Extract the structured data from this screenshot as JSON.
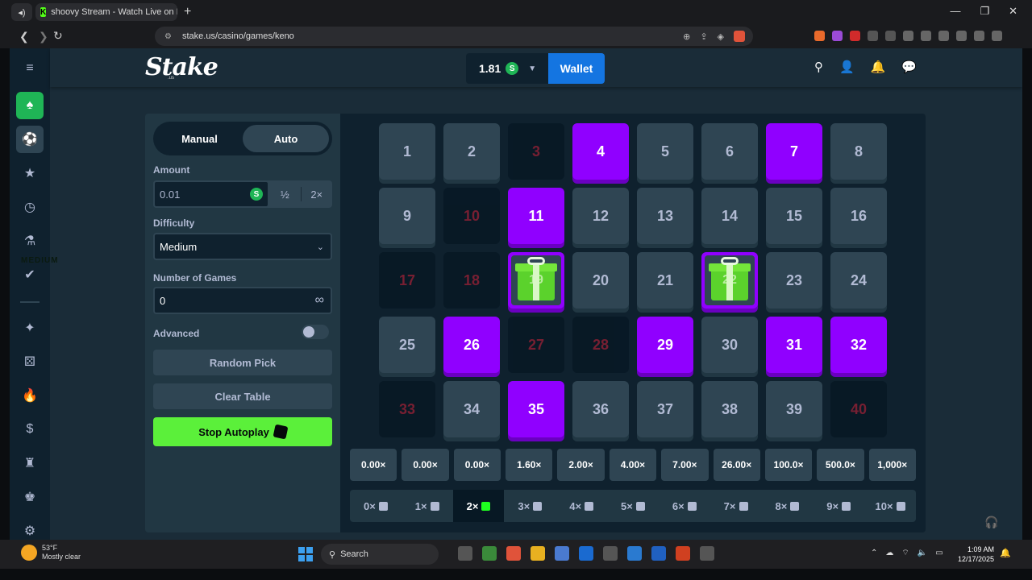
{
  "browser": {
    "tab_title": "shoovy Stream - Watch Live on K",
    "url": "stake.us/casino/games/keno"
  },
  "topbar": {
    "logo": "Stake",
    "logo_sub": ".us",
    "balance": "1.81",
    "currency_symbol": "S",
    "wallet_label": "Wallet"
  },
  "controls": {
    "mode_manual": "Manual",
    "mode_auto": "Auto",
    "amount_label": "Amount",
    "amount_value": "0.01",
    "half_label": "½",
    "double_label": "2×",
    "difficulty_label": "Difficulty",
    "difficulty_value": "Medium",
    "games_label": "Number of Games",
    "games_value": "0",
    "infinity": "∞",
    "advanced_label": "Advanced",
    "random_pick": "Random Pick",
    "clear_table": "Clear Table",
    "stop_autoplay": "Stop Autoplay"
  },
  "board": {
    "tiles": [
      {
        "n": "1",
        "state": "normal"
      },
      {
        "n": "2",
        "state": "normal"
      },
      {
        "n": "3",
        "state": "miss"
      },
      {
        "n": "4",
        "state": "pick"
      },
      {
        "n": "5",
        "state": "normal"
      },
      {
        "n": "6",
        "state": "normal"
      },
      {
        "n": "7",
        "state": "pick"
      },
      {
        "n": "8",
        "state": "normal"
      },
      {
        "n": "9",
        "state": "normal"
      },
      {
        "n": "10",
        "state": "miss"
      },
      {
        "n": "11",
        "state": "pick"
      },
      {
        "n": "12",
        "state": "normal"
      },
      {
        "n": "13",
        "state": "normal"
      },
      {
        "n": "14",
        "state": "normal"
      },
      {
        "n": "15",
        "state": "normal"
      },
      {
        "n": "16",
        "state": "normal"
      },
      {
        "n": "17",
        "state": "miss"
      },
      {
        "n": "18",
        "state": "miss"
      },
      {
        "n": "19",
        "state": "hit"
      },
      {
        "n": "20",
        "state": "normal"
      },
      {
        "n": "21",
        "state": "normal"
      },
      {
        "n": "22",
        "state": "hit"
      },
      {
        "n": "23",
        "state": "normal"
      },
      {
        "n": "24",
        "state": "normal"
      },
      {
        "n": "25",
        "state": "normal"
      },
      {
        "n": "26",
        "state": "pick"
      },
      {
        "n": "27",
        "state": "miss"
      },
      {
        "n": "28",
        "state": "miss"
      },
      {
        "n": "29",
        "state": "pick"
      },
      {
        "n": "30",
        "state": "normal"
      },
      {
        "n": "31",
        "state": "pick"
      },
      {
        "n": "32",
        "state": "pick"
      },
      {
        "n": "33",
        "state": "miss"
      },
      {
        "n": "34",
        "state": "normal"
      },
      {
        "n": "35",
        "state": "pick"
      },
      {
        "n": "36",
        "state": "normal"
      },
      {
        "n": "37",
        "state": "normal"
      },
      {
        "n": "38",
        "state": "normal"
      },
      {
        "n": "39",
        "state": "normal"
      },
      {
        "n": "40",
        "state": "miss"
      }
    ],
    "multipliers": [
      "0.00×",
      "0.00×",
      "0.00×",
      "1.60×",
      "2.00×",
      "4.00×",
      "7.00×",
      "26.00×",
      "100.0×",
      "500.0×",
      "1,000×"
    ],
    "hit_counts": [
      {
        "label": "0×",
        "active": false
      },
      {
        "label": "1×",
        "active": false
      },
      {
        "label": "2×",
        "active": true
      },
      {
        "label": "3×",
        "active": false
      },
      {
        "label": "4×",
        "active": false
      },
      {
        "label": "5×",
        "active": false
      },
      {
        "label": "6×",
        "active": false
      },
      {
        "label": "7×",
        "active": false
      },
      {
        "label": "8×",
        "active": false
      },
      {
        "label": "9×",
        "active": false
      },
      {
        "label": "10×",
        "active": false
      }
    ]
  },
  "overlay_text": "MEDIUM",
  "taskbar": {
    "temperature": "53°F",
    "weather": "Mostly clear",
    "search_label": "Search",
    "time": "1:09 AM",
    "date": "12/17/2025"
  },
  "colors": {
    "accent_purple": "#9000ff",
    "win_green": "#1fff20",
    "wallet_blue": "#1475e1",
    "miss_red": "#e9113c"
  }
}
